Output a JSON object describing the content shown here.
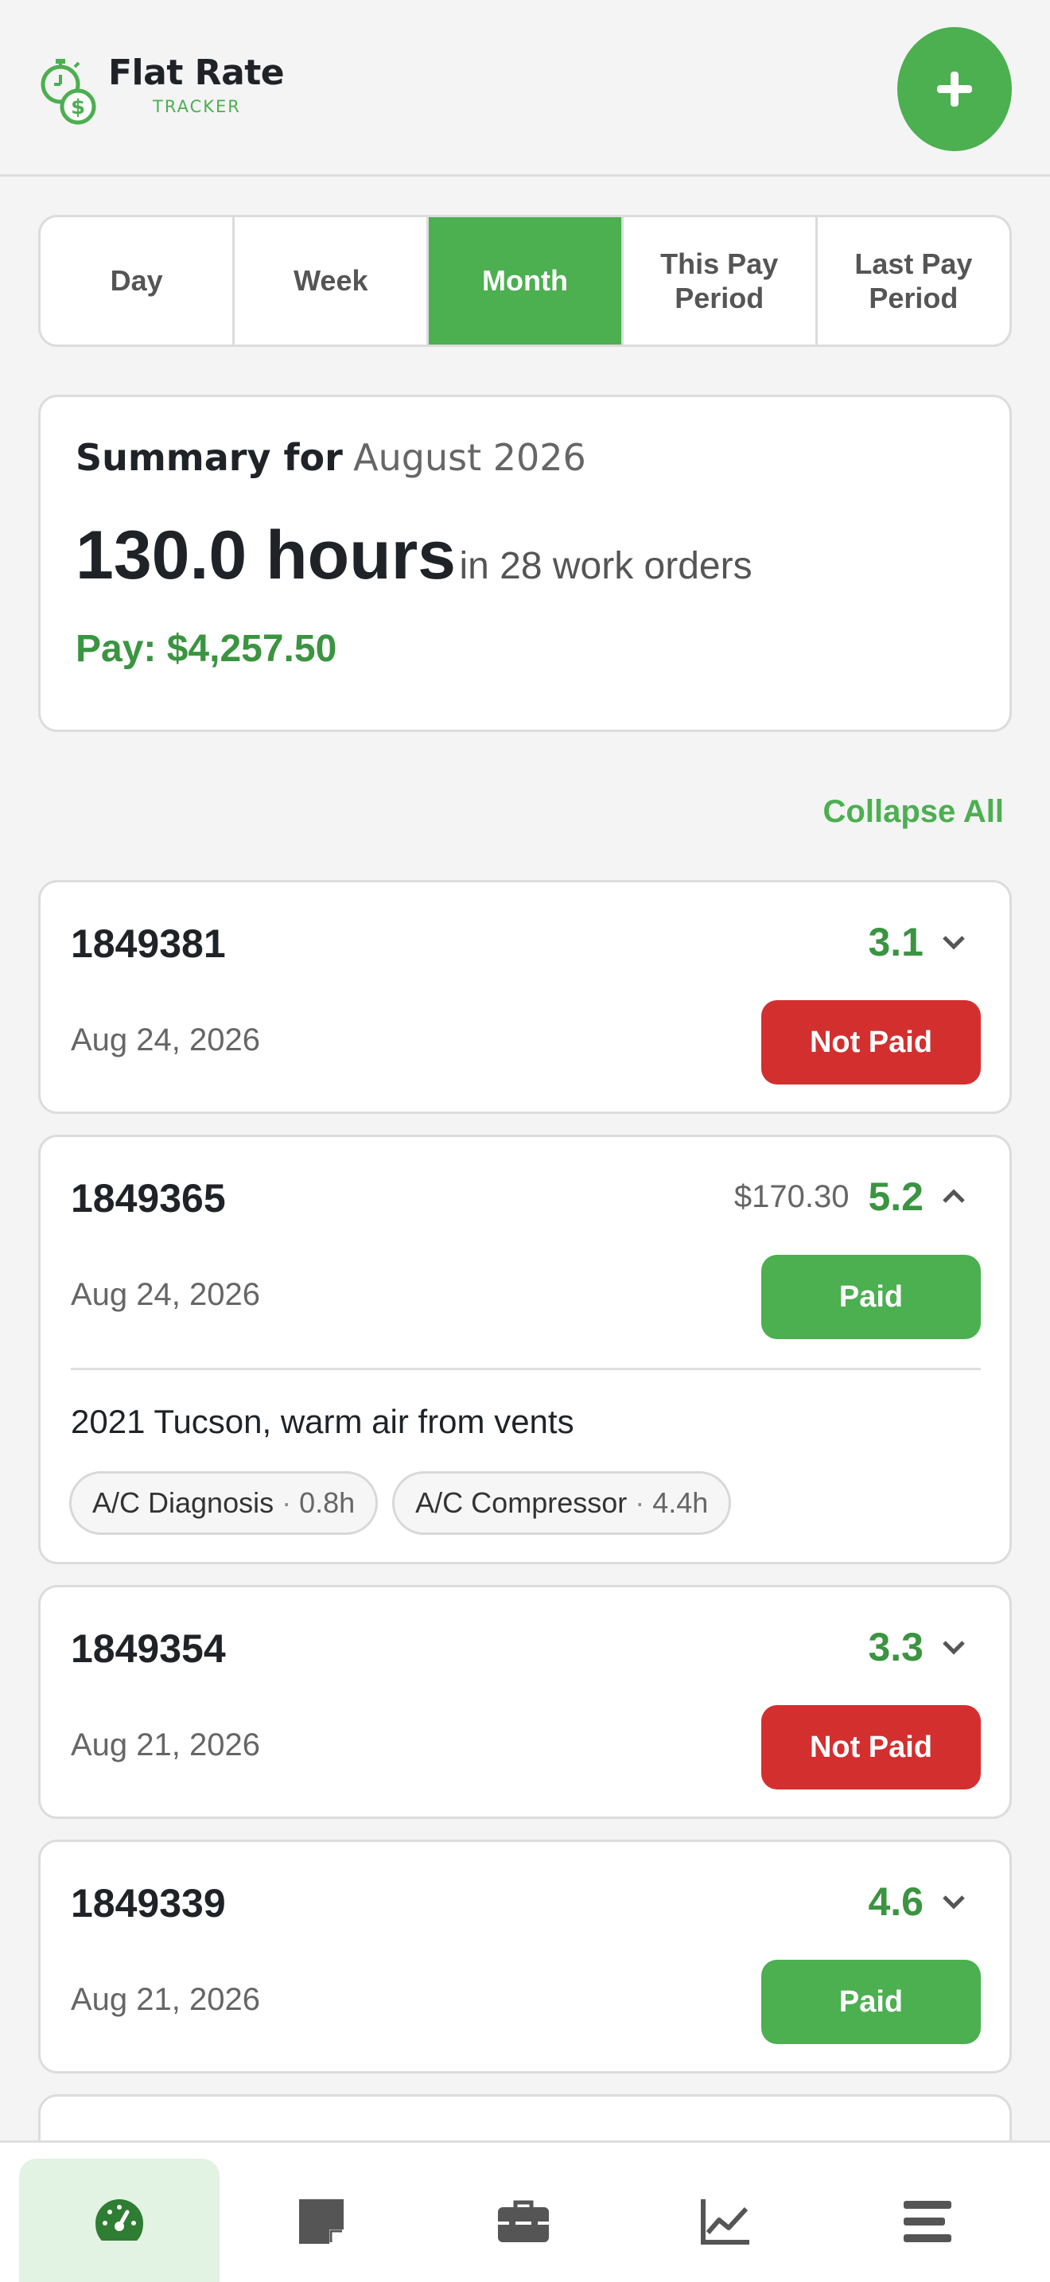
{
  "app": {
    "title": "Flat Rate",
    "subtitle": "TRACKER",
    "add_label": "+"
  },
  "colors": {
    "accent": "#4caf50",
    "not_paid": "#d32f2f",
    "hours_text": "#3a9440"
  },
  "tabs": [
    {
      "label": "Day",
      "active": false
    },
    {
      "label": "Week",
      "active": false
    },
    {
      "label": "Month",
      "active": true
    },
    {
      "label": "This Pay Period",
      "active": false
    },
    {
      "label": "Last Pay Period",
      "active": false
    }
  ],
  "summary": {
    "label": "Summary for",
    "period": "August 2026",
    "hours": "130.0 hours",
    "orders": "in 28 work orders",
    "pay": "Pay: $4,257.50"
  },
  "collapse_all_label": "Collapse All",
  "work_orders": [
    {
      "number": "1849381",
      "hours": "3.1",
      "date": "Aug 24, 2026",
      "status": "Not Paid",
      "expanded": false,
      "chevron_icon": "chevron-down-icon"
    },
    {
      "number": "1849365",
      "amount": "$170.30",
      "hours": "5.2",
      "date": "Aug 24, 2026",
      "status": "Paid",
      "expanded": true,
      "chevron_icon": "chevron-up-icon",
      "description": "2021 Tucson, warm air from vents",
      "operations": [
        {
          "name": "A/C Diagnosis",
          "hours": "0.8h"
        },
        {
          "name": "A/C Compressor",
          "hours": "4.4h"
        }
      ]
    },
    {
      "number": "1849354",
      "hours": "3.3",
      "date": "Aug 21, 2026",
      "status": "Not Paid",
      "expanded": false,
      "chevron_icon": "chevron-down-icon"
    },
    {
      "number": "1849339",
      "hours": "4.6",
      "date": "Aug 21, 2026",
      "status": "Paid",
      "expanded": false,
      "chevron_icon": "chevron-down-icon"
    }
  ],
  "bottom_nav": [
    {
      "icon": "dashboard-icon",
      "active": true
    },
    {
      "icon": "notes-icon",
      "active": false
    },
    {
      "icon": "toolbox-icon",
      "active": false
    },
    {
      "icon": "chart-icon",
      "active": false
    },
    {
      "icon": "menu-icon",
      "active": false
    }
  ]
}
